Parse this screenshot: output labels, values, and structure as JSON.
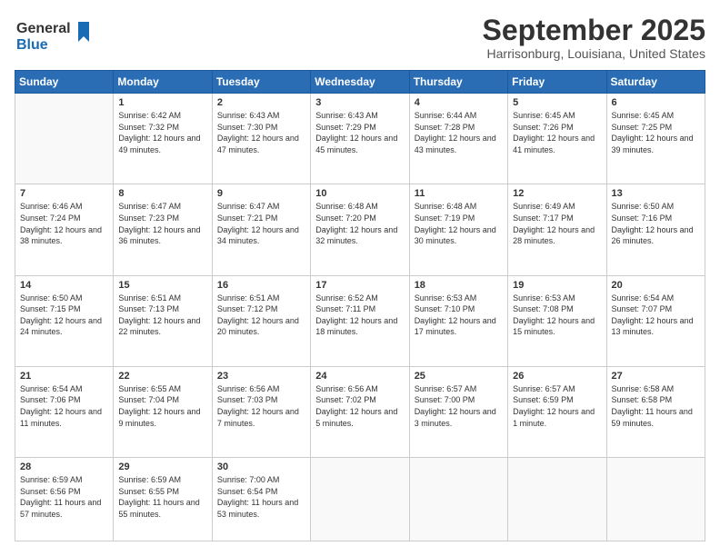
{
  "header": {
    "logo_line1": "General",
    "logo_line2": "Blue",
    "month": "September 2025",
    "location": "Harrisonburg, Louisiana, United States"
  },
  "weekdays": [
    "Sunday",
    "Monday",
    "Tuesday",
    "Wednesday",
    "Thursday",
    "Friday",
    "Saturday"
  ],
  "weeks": [
    [
      {
        "day": "",
        "sunrise": "",
        "sunset": "",
        "daylight": ""
      },
      {
        "day": "1",
        "sunrise": "Sunrise: 6:42 AM",
        "sunset": "Sunset: 7:32 PM",
        "daylight": "Daylight: 12 hours and 49 minutes."
      },
      {
        "day": "2",
        "sunrise": "Sunrise: 6:43 AM",
        "sunset": "Sunset: 7:30 PM",
        "daylight": "Daylight: 12 hours and 47 minutes."
      },
      {
        "day": "3",
        "sunrise": "Sunrise: 6:43 AM",
        "sunset": "Sunset: 7:29 PM",
        "daylight": "Daylight: 12 hours and 45 minutes."
      },
      {
        "day": "4",
        "sunrise": "Sunrise: 6:44 AM",
        "sunset": "Sunset: 7:28 PM",
        "daylight": "Daylight: 12 hours and 43 minutes."
      },
      {
        "day": "5",
        "sunrise": "Sunrise: 6:45 AM",
        "sunset": "Sunset: 7:26 PM",
        "daylight": "Daylight: 12 hours and 41 minutes."
      },
      {
        "day": "6",
        "sunrise": "Sunrise: 6:45 AM",
        "sunset": "Sunset: 7:25 PM",
        "daylight": "Daylight: 12 hours and 39 minutes."
      }
    ],
    [
      {
        "day": "7",
        "sunrise": "Sunrise: 6:46 AM",
        "sunset": "Sunset: 7:24 PM",
        "daylight": "Daylight: 12 hours and 38 minutes."
      },
      {
        "day": "8",
        "sunrise": "Sunrise: 6:47 AM",
        "sunset": "Sunset: 7:23 PM",
        "daylight": "Daylight: 12 hours and 36 minutes."
      },
      {
        "day": "9",
        "sunrise": "Sunrise: 6:47 AM",
        "sunset": "Sunset: 7:21 PM",
        "daylight": "Daylight: 12 hours and 34 minutes."
      },
      {
        "day": "10",
        "sunrise": "Sunrise: 6:48 AM",
        "sunset": "Sunset: 7:20 PM",
        "daylight": "Daylight: 12 hours and 32 minutes."
      },
      {
        "day": "11",
        "sunrise": "Sunrise: 6:48 AM",
        "sunset": "Sunset: 7:19 PM",
        "daylight": "Daylight: 12 hours and 30 minutes."
      },
      {
        "day": "12",
        "sunrise": "Sunrise: 6:49 AM",
        "sunset": "Sunset: 7:17 PM",
        "daylight": "Daylight: 12 hours and 28 minutes."
      },
      {
        "day": "13",
        "sunrise": "Sunrise: 6:50 AM",
        "sunset": "Sunset: 7:16 PM",
        "daylight": "Daylight: 12 hours and 26 minutes."
      }
    ],
    [
      {
        "day": "14",
        "sunrise": "Sunrise: 6:50 AM",
        "sunset": "Sunset: 7:15 PM",
        "daylight": "Daylight: 12 hours and 24 minutes."
      },
      {
        "day": "15",
        "sunrise": "Sunrise: 6:51 AM",
        "sunset": "Sunset: 7:13 PM",
        "daylight": "Daylight: 12 hours and 22 minutes."
      },
      {
        "day": "16",
        "sunrise": "Sunrise: 6:51 AM",
        "sunset": "Sunset: 7:12 PM",
        "daylight": "Daylight: 12 hours and 20 minutes."
      },
      {
        "day": "17",
        "sunrise": "Sunrise: 6:52 AM",
        "sunset": "Sunset: 7:11 PM",
        "daylight": "Daylight: 12 hours and 18 minutes."
      },
      {
        "day": "18",
        "sunrise": "Sunrise: 6:53 AM",
        "sunset": "Sunset: 7:10 PM",
        "daylight": "Daylight: 12 hours and 17 minutes."
      },
      {
        "day": "19",
        "sunrise": "Sunrise: 6:53 AM",
        "sunset": "Sunset: 7:08 PM",
        "daylight": "Daylight: 12 hours and 15 minutes."
      },
      {
        "day": "20",
        "sunrise": "Sunrise: 6:54 AM",
        "sunset": "Sunset: 7:07 PM",
        "daylight": "Daylight: 12 hours and 13 minutes."
      }
    ],
    [
      {
        "day": "21",
        "sunrise": "Sunrise: 6:54 AM",
        "sunset": "Sunset: 7:06 PM",
        "daylight": "Daylight: 12 hours and 11 minutes."
      },
      {
        "day": "22",
        "sunrise": "Sunrise: 6:55 AM",
        "sunset": "Sunset: 7:04 PM",
        "daylight": "Daylight: 12 hours and 9 minutes."
      },
      {
        "day": "23",
        "sunrise": "Sunrise: 6:56 AM",
        "sunset": "Sunset: 7:03 PM",
        "daylight": "Daylight: 12 hours and 7 minutes."
      },
      {
        "day": "24",
        "sunrise": "Sunrise: 6:56 AM",
        "sunset": "Sunset: 7:02 PM",
        "daylight": "Daylight: 12 hours and 5 minutes."
      },
      {
        "day": "25",
        "sunrise": "Sunrise: 6:57 AM",
        "sunset": "Sunset: 7:00 PM",
        "daylight": "Daylight: 12 hours and 3 minutes."
      },
      {
        "day": "26",
        "sunrise": "Sunrise: 6:57 AM",
        "sunset": "Sunset: 6:59 PM",
        "daylight": "Daylight: 12 hours and 1 minute."
      },
      {
        "day": "27",
        "sunrise": "Sunrise: 6:58 AM",
        "sunset": "Sunset: 6:58 PM",
        "daylight": "Daylight: 11 hours and 59 minutes."
      }
    ],
    [
      {
        "day": "28",
        "sunrise": "Sunrise: 6:59 AM",
        "sunset": "Sunset: 6:56 PM",
        "daylight": "Daylight: 11 hours and 57 minutes."
      },
      {
        "day": "29",
        "sunrise": "Sunrise: 6:59 AM",
        "sunset": "Sunset: 6:55 PM",
        "daylight": "Daylight: 11 hours and 55 minutes."
      },
      {
        "day": "30",
        "sunrise": "Sunrise: 7:00 AM",
        "sunset": "Sunset: 6:54 PM",
        "daylight": "Daylight: 11 hours and 53 minutes."
      },
      {
        "day": "",
        "sunrise": "",
        "sunset": "",
        "daylight": ""
      },
      {
        "day": "",
        "sunrise": "",
        "sunset": "",
        "daylight": ""
      },
      {
        "day": "",
        "sunrise": "",
        "sunset": "",
        "daylight": ""
      },
      {
        "day": "",
        "sunrise": "",
        "sunset": "",
        "daylight": ""
      }
    ]
  ]
}
